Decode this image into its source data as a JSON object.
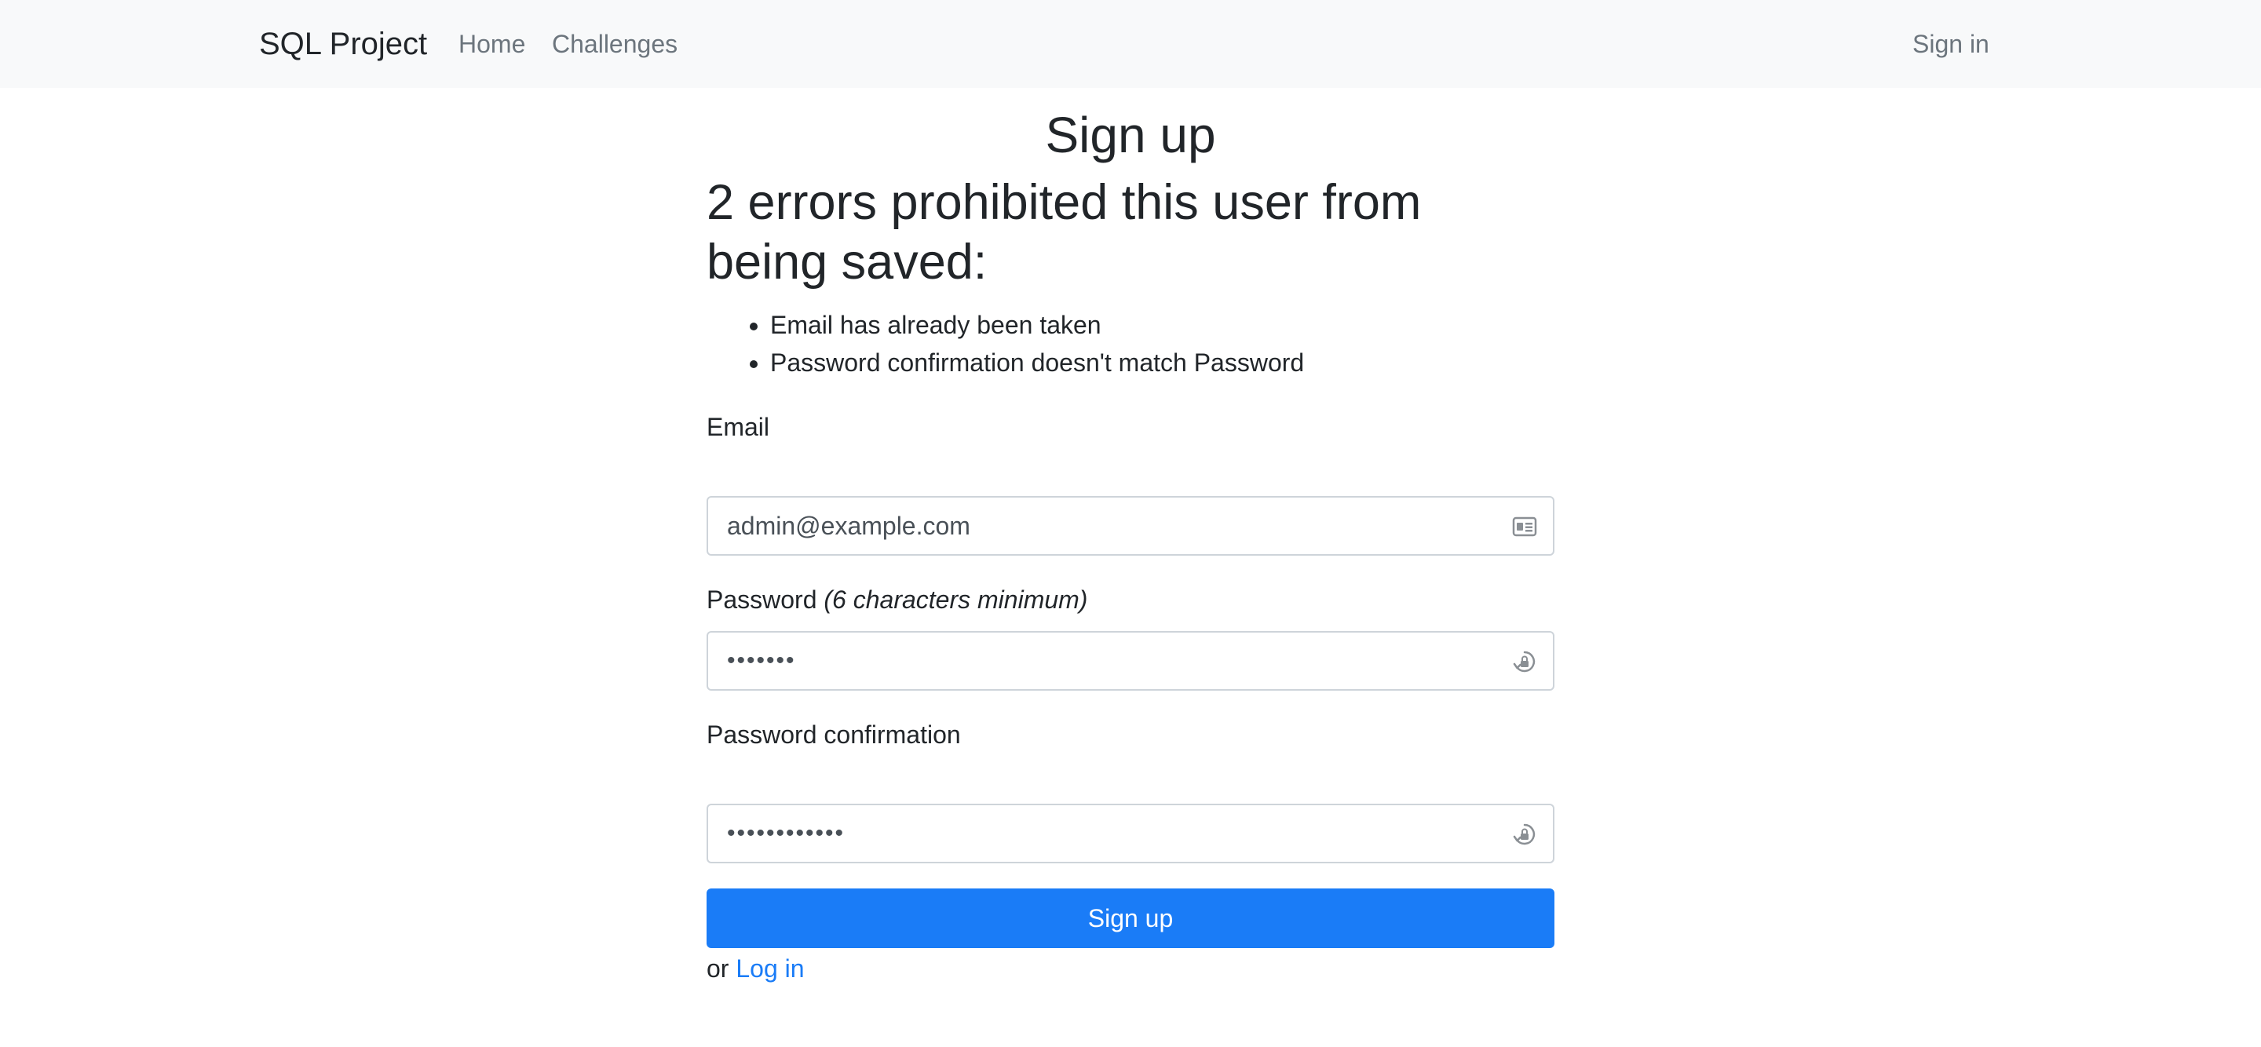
{
  "navbar": {
    "brand": "SQL Project",
    "links": [
      {
        "label": "Home"
      },
      {
        "label": "Challenges"
      }
    ],
    "sign_in": "Sign in"
  },
  "main": {
    "title": "Sign up",
    "error_heading": "2 errors prohibited this user from being saved:",
    "errors": [
      "Email has already been taken",
      "Password confirmation doesn't match Password"
    ],
    "email": {
      "label": "Email",
      "value": "admin@example.com",
      "icon": "contact-card-icon"
    },
    "password": {
      "label": "Password",
      "hint": "(6 characters minimum)",
      "value": "•••••••",
      "icon": "password-manager-icon"
    },
    "password_confirmation": {
      "label": "Password confirmation",
      "value": "••••••••••••",
      "icon": "password-manager-icon"
    },
    "submit_label": "Sign up",
    "alt_prefix": "or",
    "alt_link": "Log in"
  },
  "colors": {
    "navbar_bg": "#f8f9fa",
    "primary": "#1a7cf7",
    "muted_link": "#6c757d",
    "text": "#212529",
    "input_border": "#ced4da"
  }
}
